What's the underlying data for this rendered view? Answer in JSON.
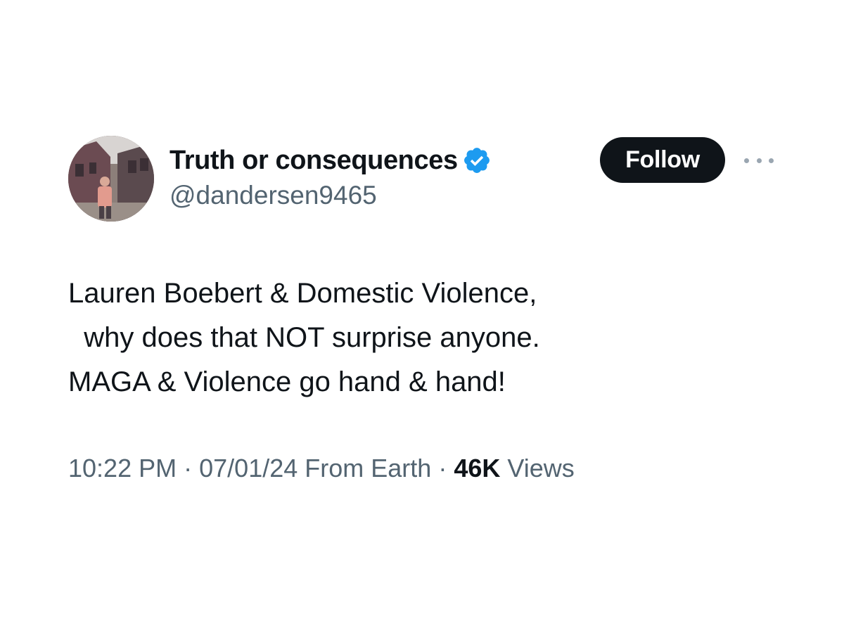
{
  "author": {
    "display_name": "Truth or consequences",
    "handle": "@dandersen9465",
    "verified": true,
    "avatar_icon": "profile-photo"
  },
  "actions": {
    "follow_label": "Follow",
    "more_icon": "ellipsis-icon"
  },
  "tweet": {
    "lines": [
      "Lauren Boebert & Domestic Violence,",
      "  why does that NOT surprise anyone.",
      "MAGA & Violence go hand & hand!"
    ]
  },
  "meta": {
    "time": "10:22 PM",
    "separator": "·",
    "date": "07/01/24",
    "source": "From Earth",
    "views_count": "46K",
    "views_label": "Views"
  },
  "colors": {
    "text_primary": "#0f1419",
    "text_secondary": "#536471",
    "verified_badge": "#1d9bf0",
    "follow_button_bg": "#0f1419"
  }
}
